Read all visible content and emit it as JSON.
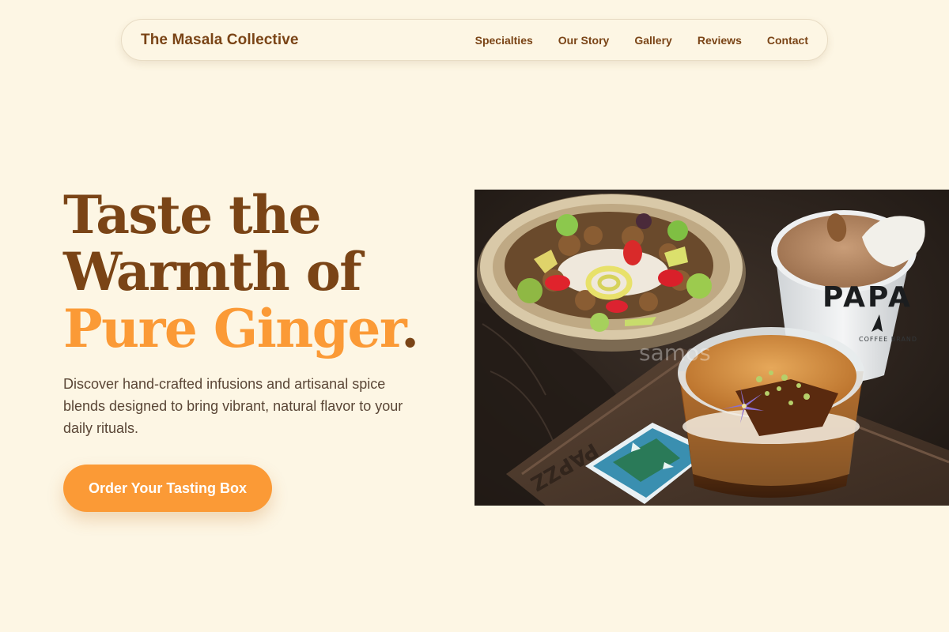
{
  "nav": {
    "brand": "The Masala Collective",
    "links": [
      "Specialties",
      "Our Story",
      "Gallery",
      "Reviews",
      "Contact"
    ]
  },
  "hero": {
    "title_line1": "Taste the",
    "title_line2": "Warmth of",
    "title_accent": "Pure Ginger",
    "title_period": ".",
    "description": "Discover hand-crafted infusions and artisanal spice blends designed to bring vibrant, natural flavor to your daily rituals.",
    "cta_label": "Order Your Tasting Box",
    "image": {
      "cup_text": "PAPA",
      "cup_subtext": "COFFEE BRAND",
      "tray_text": "PAPZZ",
      "watermark": "samos"
    }
  },
  "colors": {
    "background": "#fdf6e4",
    "brand_brown": "#7a4416",
    "accent_orange": "#fb9a36",
    "body_text": "#5a4636"
  }
}
